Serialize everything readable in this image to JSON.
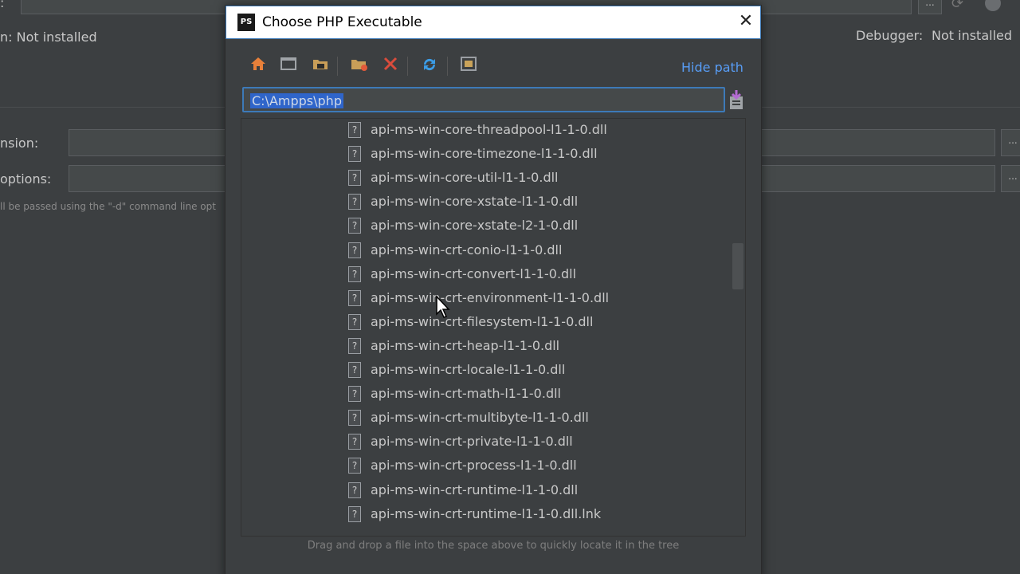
{
  "background": {
    "left_partial_label": "n: Not installed",
    "debugger_label": "Debugger:",
    "debugger_value": "Not installed",
    "version_label": "nsion:",
    "options_label": "options:",
    "options_hint": "ll be passed using the \"-d\" command line opt",
    "dots": "..."
  },
  "dialog": {
    "app_icon_text": "PS",
    "title": "Choose PHP Executable",
    "close_icon": "close-icon",
    "hide_path": "Hide path",
    "path_value": "C:\\Ampps\\php",
    "drop_hint": "Drag and drop a file into the space above to quickly locate it in the tree",
    "toolbar_icons": [
      "home-icon",
      "desktop-icon",
      "project-folder-icon",
      "new-folder-icon",
      "delete-icon",
      "refresh-icon",
      "show-hidden-icon"
    ],
    "files": [
      "api-ms-win-core-threadpool-l1-1-0.dll",
      "api-ms-win-core-timezone-l1-1-0.dll",
      "api-ms-win-core-util-l1-1-0.dll",
      "api-ms-win-core-xstate-l1-1-0.dll",
      "api-ms-win-core-xstate-l2-1-0.dll",
      "api-ms-win-crt-conio-l1-1-0.dll",
      "api-ms-win-crt-convert-l1-1-0.dll",
      "api-ms-win-crt-environment-l1-1-0.dll",
      "api-ms-win-crt-filesystem-l1-1-0.dll",
      "api-ms-win-crt-heap-l1-1-0.dll",
      "api-ms-win-crt-locale-l1-1-0.dll",
      "api-ms-win-crt-math-l1-1-0.dll",
      "api-ms-win-crt-multibyte-l1-1-0.dll",
      "api-ms-win-crt-private-l1-1-0.dll",
      "api-ms-win-crt-process-l1-1-0.dll",
      "api-ms-win-crt-runtime-l1-1-0.dll",
      "api-ms-win-crt-runtime-l1-1-0.dll.lnk"
    ],
    "file_icon_glyph": "?"
  },
  "colors": {
    "accent": "#589df6",
    "selection": "#2f65ca",
    "background": "#3c3f41"
  }
}
